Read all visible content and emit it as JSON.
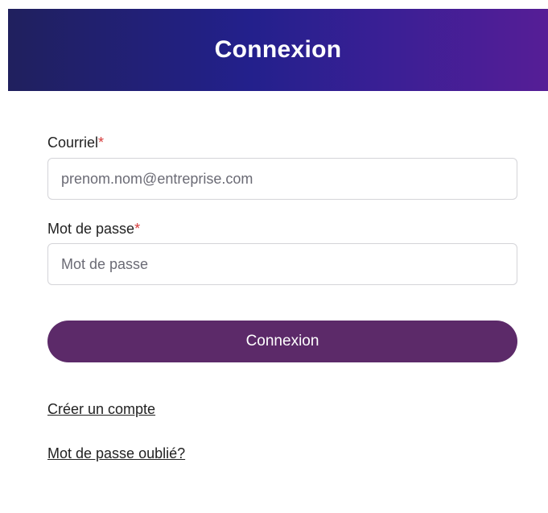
{
  "header": {
    "title": "Connexion"
  },
  "form": {
    "email": {
      "label": "Courriel",
      "required_mark": "*",
      "placeholder": "prenom.nom@entreprise.com",
      "value": ""
    },
    "password": {
      "label": "Mot de passe",
      "required_mark": "*",
      "placeholder": "Mot de passe",
      "value": ""
    },
    "submit_label": "Connexion"
  },
  "links": {
    "create_account": "Créer un compte",
    "forgot_password": "Mot de passe oublié?"
  },
  "colors": {
    "header_gradient_start": "#20205e",
    "header_gradient_end": "#561e96",
    "button": "#5c2a69",
    "required": "#d63a3a"
  }
}
